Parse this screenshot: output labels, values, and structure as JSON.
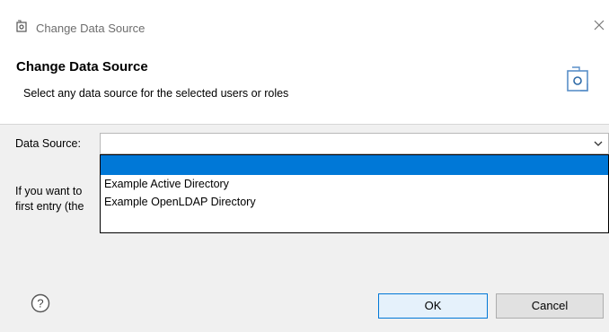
{
  "window": {
    "title": "Change Data Source",
    "close_icon": "close-icon"
  },
  "header": {
    "title": "Change Data Source",
    "message": "Select any data source for the selected users or roles",
    "icon": "data-source-icon"
  },
  "form": {
    "data_source_label": "Data Source:",
    "data_source_value": "",
    "options": [
      "",
      "Example Active Directory",
      "Example OpenLDAP Directory"
    ],
    "help_text_line1": "If you want to",
    "help_text_line2": "first entry (the"
  },
  "buttons": {
    "ok": "OK",
    "cancel": "Cancel",
    "help_icon": "help-icon"
  },
  "colors": {
    "selection": "#0078d7",
    "body_bg": "#f0f0f0",
    "header_bg": "#ffffff"
  }
}
